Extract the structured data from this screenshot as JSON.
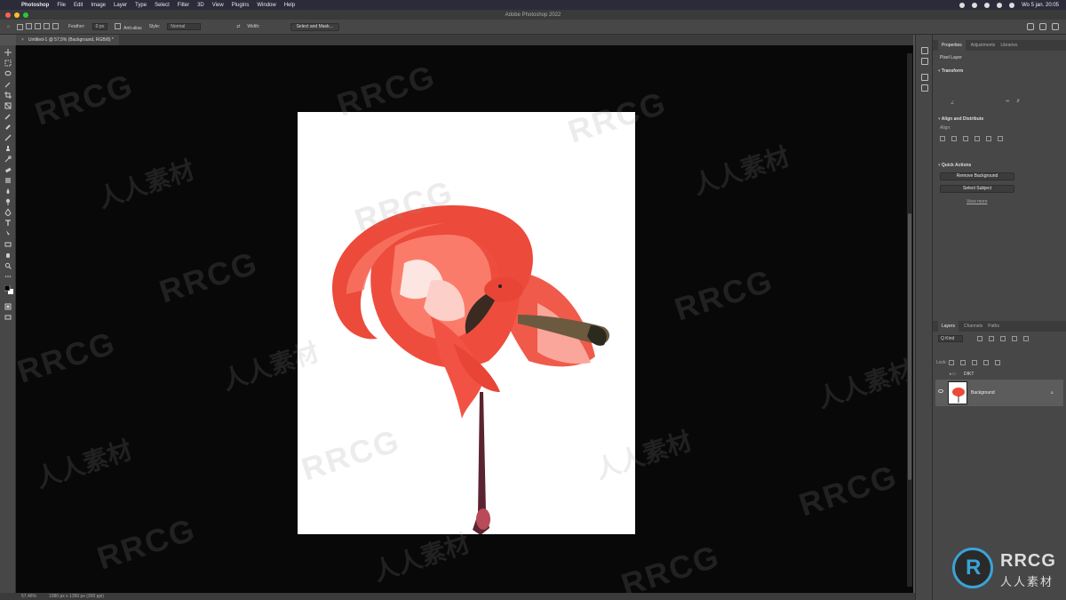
{
  "menubar": {
    "app": "Photoshop",
    "items": [
      "File",
      "Edit",
      "Image",
      "Layer",
      "Type",
      "Select",
      "Filter",
      "3D",
      "View",
      "Plugins",
      "Window",
      "Help"
    ],
    "clock": "Wo 5 jan.  20:05"
  },
  "window": {
    "title": "Adobe Photoshop 2022"
  },
  "options": {
    "feather_label": "Feather:",
    "feather_value": "0 px",
    "antialias_label": "Anti-alias",
    "style_label": "Style:",
    "style_value": "Normal",
    "width_label": "Width:",
    "select_mask_label": "Select and Mask..."
  },
  "document_tab": {
    "close": "×",
    "title": "Untitled-1 @ 57,5% (Background, RGB/8) *"
  },
  "statusbar": {
    "zoom": "57,46%",
    "doc_size": "1080 px x 1350 px (300 ppi)"
  },
  "properties": {
    "tabs": [
      "Properties",
      "Adjustments",
      "Libraries"
    ],
    "pixel_layer": "Pixel Layer",
    "transform_title": "Transform",
    "align_title": "Align and Distribute",
    "align_sub": "Align:",
    "quick_actions_title": "Quick Actions",
    "remove_bg": "Remove Background",
    "select_subject": "Select Subject",
    "view_more": "View more"
  },
  "layers": {
    "tabs": [
      "Layers",
      "Channels",
      "Paths"
    ],
    "kind": "Q Kind",
    "lock_label": "Lock:",
    "group_name": "DIKT",
    "layer_name": "Background"
  },
  "watermarks": {
    "latin": "RRCG",
    "cn": "人人素材"
  },
  "logo": {
    "text": "RRCG",
    "sub": "人人素材"
  }
}
